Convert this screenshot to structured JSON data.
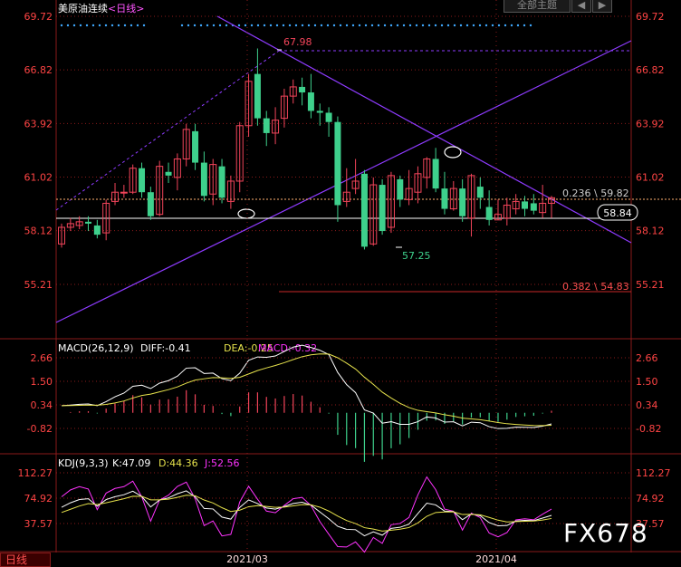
{
  "header": {
    "title": "美原油连续",
    "period_link": "<日线>",
    "theme_button": "全部主题",
    "prev_icon": "◀",
    "next_icon": "▶"
  },
  "footer": {
    "period_tab": "日线",
    "watermark": "FX678"
  },
  "colors": {
    "up": "#f2445a",
    "down": "#3ed08c",
    "axis_text": "#ff4444",
    "grid": "#8a1a1a",
    "trend": "#8e3bff",
    "hline": "#ffffff",
    "ma_white": "#ffffff",
    "ma_yellow": "#e6e24c",
    "magenta": "#ff33ff"
  },
  "chart_data": [
    {
      "type": "candlestick",
      "panel": "price",
      "y_ticks": [
        "69.72",
        "66.82",
        "63.92",
        "61.02",
        "58.12",
        "55.21"
      ],
      "ylim": [
        53.8,
        70.2
      ],
      "x_ticks": [
        "2021/03",
        "2021/04"
      ],
      "candles": [
        [
          57.4,
          58.3,
          58.5,
          57.2
        ],
        [
          58.3,
          58.5,
          58.8,
          58.1
        ],
        [
          58.4,
          58.6,
          58.9,
          58.2
        ],
        [
          58.6,
          58.5,
          58.9,
          58.1
        ],
        [
          58.4,
          57.9,
          58.7,
          57.7
        ],
        [
          58.0,
          59.6,
          59.8,
          57.6
        ],
        [
          59.7,
          60.2,
          60.7,
          59.5
        ],
        [
          60.2,
          60.2,
          60.6,
          59.9
        ],
        [
          60.2,
          61.5,
          61.7,
          60.1
        ],
        [
          61.5,
          60.2,
          61.8,
          59.9
        ],
        [
          60.2,
          58.9,
          60.5,
          58.7
        ],
        [
          59.0,
          61.6,
          61.9,
          58.9
        ],
        [
          61.3,
          61.1,
          61.8,
          60.7
        ],
        [
          61.0,
          62.0,
          62.3,
          60.3
        ],
        [
          62.0,
          63.6,
          63.9,
          61.6
        ],
        [
          63.5,
          61.8,
          63.9,
          61.4
        ],
        [
          61.8,
          60.0,
          62.4,
          59.7
        ],
        [
          60.1,
          61.7,
          62.0,
          59.5
        ],
        [
          61.6,
          59.9,
          62.0,
          59.6
        ],
        [
          59.7,
          60.8,
          61.1,
          59.3
        ],
        [
          60.8,
          63.8,
          64.0,
          60.2
        ],
        [
          63.8,
          66.2,
          66.6,
          63.2
        ],
        [
          66.6,
          64.2,
          67.98,
          63.8
        ],
        [
          64.2,
          63.4,
          64.6,
          62.7
        ],
        [
          63.4,
          64.1,
          64.8,
          62.8
        ],
        [
          64.2,
          65.4,
          65.8,
          63.7
        ],
        [
          65.4,
          65.9,
          66.3,
          65.0
        ],
        [
          65.9,
          65.6,
          66.4,
          64.9
        ],
        [
          65.6,
          64.6,
          66.6,
          64.2
        ],
        [
          64.6,
          64.5,
          65.0,
          63.8
        ],
        [
          64.5,
          64.0,
          64.8,
          63.2
        ],
        [
          64.0,
          59.5,
          64.3,
          58.6
        ],
        [
          59.7,
          60.2,
          61.5,
          59.4
        ],
        [
          60.4,
          60.8,
          62.0,
          60.1
        ],
        [
          61.2,
          57.25,
          61.4,
          57.1
        ],
        [
          57.4,
          60.6,
          61.0,
          57.3
        ],
        [
          60.6,
          58.1,
          60.9,
          57.9
        ],
        [
          58.3,
          61.1,
          61.3,
          58.0
        ],
        [
          60.9,
          59.8,
          61.1,
          59.4
        ],
        [
          59.8,
          60.4,
          61.4,
          59.5
        ],
        [
          60.2,
          61.2,
          61.6,
          59.6
        ],
        [
          61.0,
          62.0,
          62.1,
          60.4
        ],
        [
          62.0,
          60.4,
          62.6,
          60.2
        ],
        [
          60.4,
          59.3,
          61.3,
          59.0
        ],
        [
          59.3,
          60.4,
          60.8,
          59.2
        ],
        [
          60.4,
          58.9,
          60.9,
          58.6
        ],
        [
          58.8,
          61.1,
          61.2,
          57.8
        ],
        [
          60.5,
          59.9,
          61.0,
          59.3
        ],
        [
          59.4,
          58.7,
          60.3,
          58.4
        ],
        [
          58.7,
          59.0,
          59.8,
          58.7
        ],
        [
          58.8,
          59.5,
          59.9,
          58.4
        ],
        [
          59.3,
          59.7,
          60.1,
          59.0
        ],
        [
          59.7,
          59.3,
          60.0,
          58.9
        ],
        [
          59.6,
          59.2,
          60.1,
          59.0
        ],
        [
          59.1,
          59.6,
          60.6,
          58.8
        ],
        [
          59.6,
          59.9,
          60.0,
          58.8
        ]
      ],
      "annotations": {
        "high_label": "67.98",
        "low_label": "57.25",
        "fib_236": "0.236 \\ 59.82",
        "fib_236_value": 59.82,
        "fib_382": "0.382 \\ 54.83",
        "fib_382_value": 54.83,
        "current_price": "58.84",
        "current_value": 58.84
      }
    },
    {
      "type": "macd",
      "panel": "macd",
      "title": "MACD(26,12,9)",
      "diff_label": "DIFF:-0.41",
      "dea_label": "DEA:-0.25",
      "macd_label": "MACD:-0.32",
      "y_ticks_left": [
        "2.66",
        "1.50",
        "0.34",
        "-0.82"
      ],
      "y_ticks_right": [
        "2.66",
        "1.50",
        "0.34",
        "-0.82"
      ],
      "ylim": [
        -2.1,
        3.0
      ]
    },
    {
      "type": "kdj",
      "panel": "kdj",
      "title": "KDJ(9,3,3)",
      "k_label": "K:47.09",
      "d_label": "D:44.36",
      "j_label": "J:52.56",
      "y_ticks_left": [
        "112.27",
        "74.92",
        "37.57"
      ],
      "y_ticks_right": [
        "112.27",
        "74.92",
        "37.57"
      ],
      "ylim": [
        0,
        120
      ]
    }
  ]
}
